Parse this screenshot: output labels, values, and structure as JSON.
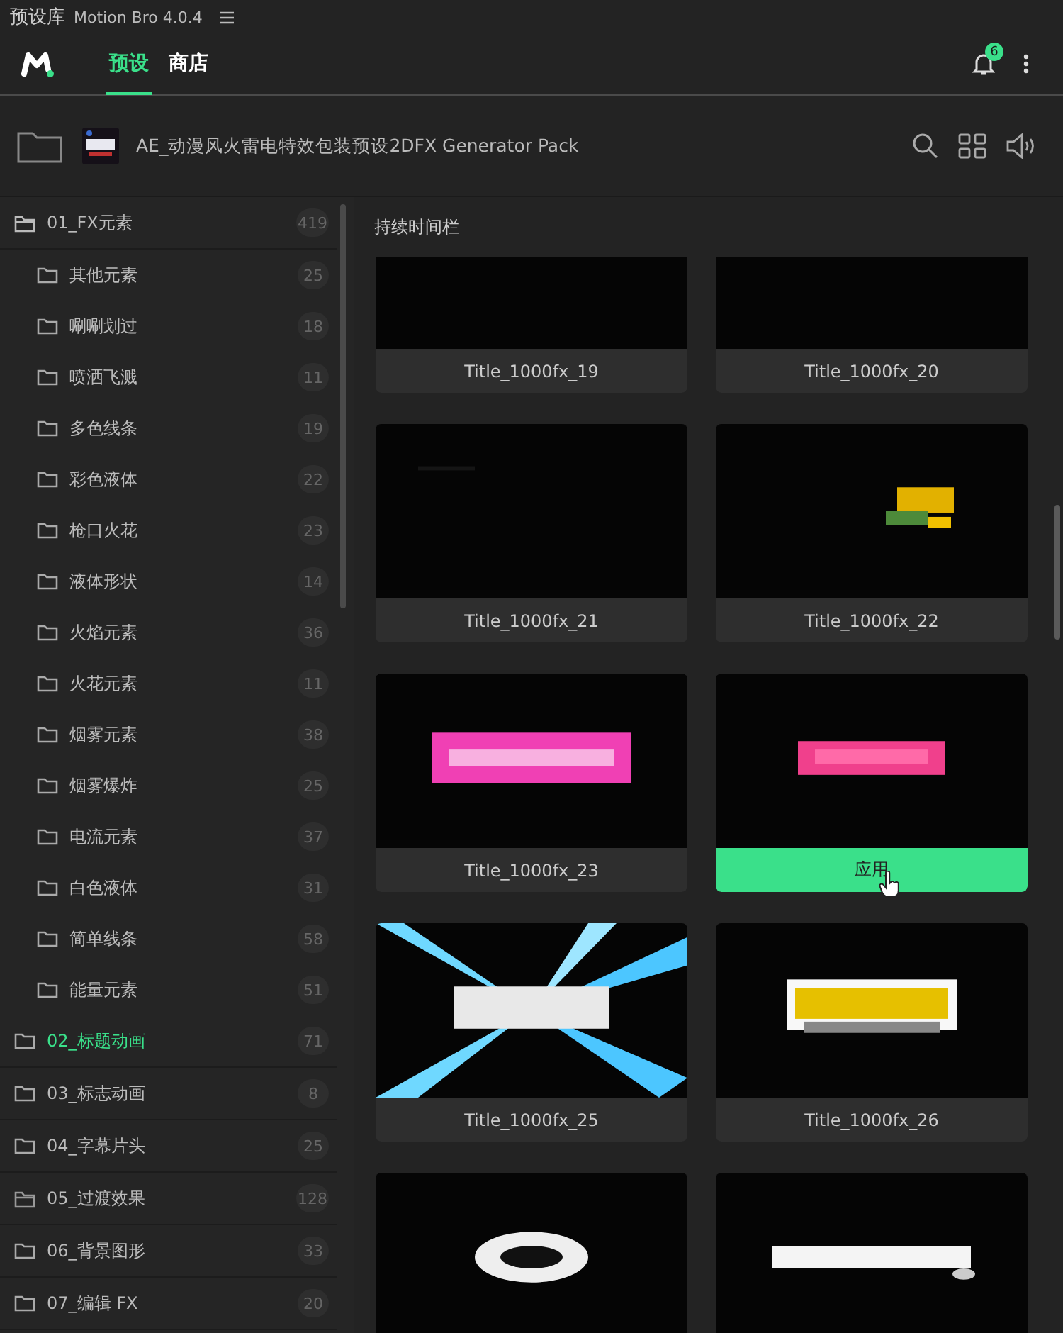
{
  "window": {
    "title": "预设库",
    "app": "Motion Bro 4.0.4"
  },
  "nav": {
    "tabs": [
      {
        "label": "预设",
        "selected": true
      },
      {
        "label": "商店",
        "selected": false
      }
    ],
    "notification_count": "6"
  },
  "pack": {
    "title": "AE_动漫风火雷电特效包装预设2DFX Generator Pack"
  },
  "sidebar": {
    "items": [
      {
        "label": "01_FX元素",
        "count": "419",
        "kind": "group",
        "selected": false,
        "expanded": true,
        "children": [
          {
            "label": "其他元素",
            "count": "25"
          },
          {
            "label": "唰唰划过",
            "count": "18"
          },
          {
            "label": "喷洒飞溅",
            "count": "11"
          },
          {
            "label": "多色线条",
            "count": "19"
          },
          {
            "label": "彩色液体",
            "count": "22"
          },
          {
            "label": "枪口火花",
            "count": "23"
          },
          {
            "label": "液体形状",
            "count": "14"
          },
          {
            "label": "火焰元素",
            "count": "36"
          },
          {
            "label": "火花元素",
            "count": "11"
          },
          {
            "label": "烟雾元素",
            "count": "38"
          },
          {
            "label": "烟雾爆炸",
            "count": "25"
          },
          {
            "label": "电流元素",
            "count": "37"
          },
          {
            "label": "白色液体",
            "count": "31"
          },
          {
            "label": "简单线条",
            "count": "58"
          },
          {
            "label": "能量元素",
            "count": "51"
          }
        ]
      },
      {
        "label": "02_标题动画",
        "count": "71",
        "kind": "folder",
        "selected": true
      },
      {
        "label": "03_标志动画",
        "count": "8",
        "kind": "folder",
        "selected": false
      },
      {
        "label": "04_字幕片头",
        "count": "25",
        "kind": "folder",
        "selected": false
      },
      {
        "label": "05_过渡效果",
        "count": "128",
        "kind": "group",
        "selected": false
      },
      {
        "label": "06_背景图形",
        "count": "33",
        "kind": "folder",
        "selected": false
      },
      {
        "label": "07_编辑 FX",
        "count": "20",
        "kind": "folder",
        "selected": false
      }
    ]
  },
  "content": {
    "heading": "持续时间栏",
    "cards": [
      {
        "kind": "label",
        "title": "Title_1000fx_19"
      },
      {
        "kind": "label",
        "title": "Title_1000fx_20"
      },
      {
        "kind": "label",
        "title": "Title_1000fx_21"
      },
      {
        "kind": "label",
        "title": "Title_1000fx_22"
      },
      {
        "kind": "label",
        "title": "Title_1000fx_23"
      },
      {
        "kind": "apply",
        "title": "应用"
      },
      {
        "kind": "label",
        "title": "Title_1000fx_25"
      },
      {
        "kind": "label",
        "title": "Title_1000fx_26"
      },
      {
        "kind": "none"
      },
      {
        "kind": "none"
      }
    ]
  }
}
